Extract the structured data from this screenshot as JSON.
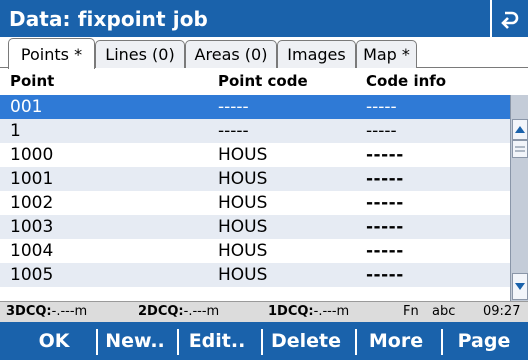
{
  "title": "Data: fixpoint job",
  "tabs": [
    {
      "label": "Points *"
    },
    {
      "label": "Lines (0)"
    },
    {
      "label": "Areas (0)"
    },
    {
      "label": "Images"
    },
    {
      "label": "Map *"
    }
  ],
  "table": {
    "headers": [
      "Point",
      "Point code",
      "Code info"
    ],
    "rows": [
      {
        "point": "001",
        "code": "-----",
        "info": "-----"
      },
      {
        "point": "1",
        "code": "-----",
        "info": "-----"
      },
      {
        "point": "1000",
        "code": "HOUS",
        "info": "-----"
      },
      {
        "point": "1001",
        "code": "HOUS",
        "info": "-----"
      },
      {
        "point": "1002",
        "code": "HOUS",
        "info": "-----"
      },
      {
        "point": "1003",
        "code": "HOUS",
        "info": "-----"
      },
      {
        "point": "1004",
        "code": "HOUS",
        "info": "-----"
      },
      {
        "point": "1005",
        "code": "HOUS",
        "info": "-----"
      }
    ],
    "selected_index": 0
  },
  "status": {
    "q3_label": "3DCQ:",
    "q3_value": "-.---m",
    "q2_label": "2DCQ:",
    "q2_value": "-.---m",
    "q1_label": "1DCQ:",
    "q1_value": "-.---m",
    "fn": "Fn",
    "input_mode": "abc",
    "time": "09:27"
  },
  "softkeys": [
    "OK",
    "New..",
    "Edit..",
    "Delete",
    "More",
    "Page"
  ],
  "colors": {
    "bar": "#1a62ab",
    "selected_row": "#2f7ad6",
    "alt_row": "#e6ebf3"
  },
  "icons": {
    "back": "return-arrow-icon",
    "scroll_up": "triangle-up-icon",
    "scroll_down": "triangle-down-icon"
  }
}
